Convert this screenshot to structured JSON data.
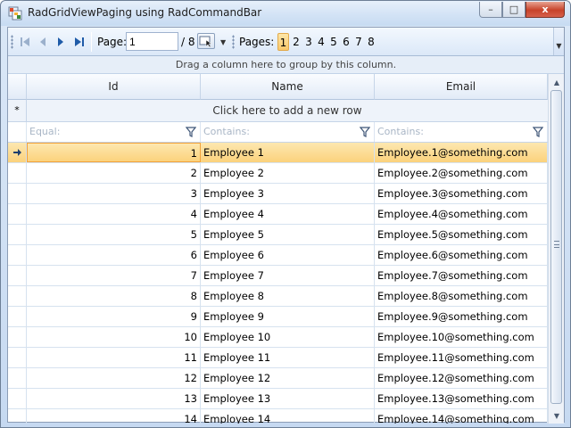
{
  "window": {
    "title": "RadGridViewPaging using RadCommandBar",
    "minimize_glyph": "–",
    "maximize_glyph": "□",
    "close_glyph": "x"
  },
  "commandbar": {
    "page_label": "Page:",
    "page_value": "1",
    "page_total": "/ 8",
    "pages_label": "Pages:",
    "pages": [
      "1",
      "2",
      "3",
      "4",
      "5",
      "6",
      "7",
      "8"
    ],
    "active_page": "1",
    "icons": [
      "first-page-icon",
      "previous-page-icon",
      "next-page-icon",
      "last-page-icon",
      "go-page-icon",
      "overflow-icon"
    ]
  },
  "grid": {
    "group_panel_text": "Drag a column here to group by this column.",
    "new_row_text": "Click here to add a new row",
    "new_row_glyph": "*",
    "columns": [
      {
        "header": "Id",
        "filter": "Equal:"
      },
      {
        "header": "Name",
        "filter": "Contains:"
      },
      {
        "header": "Email",
        "filter": "Contains:"
      }
    ],
    "current_row_index": 0,
    "rows": [
      {
        "id": "1",
        "name": "Employee 1",
        "email": "Employee.1@something.com"
      },
      {
        "id": "2",
        "name": "Employee 2",
        "email": "Employee.2@something.com"
      },
      {
        "id": "3",
        "name": "Employee 3",
        "email": "Employee.3@something.com"
      },
      {
        "id": "4",
        "name": "Employee 4",
        "email": "Employee.4@something.com"
      },
      {
        "id": "5",
        "name": "Employee 5",
        "email": "Employee.5@something.com"
      },
      {
        "id": "6",
        "name": "Employee 6",
        "email": "Employee.6@something.com"
      },
      {
        "id": "7",
        "name": "Employee 7",
        "email": "Employee.7@something.com"
      },
      {
        "id": "8",
        "name": "Employee 8",
        "email": "Employee.8@something.com"
      },
      {
        "id": "9",
        "name": "Employee 9",
        "email": "Employee.9@something.com"
      },
      {
        "id": "10",
        "name": "Employee 10",
        "email": "Employee.10@something.com"
      },
      {
        "id": "11",
        "name": "Employee 11",
        "email": "Employee.11@something.com"
      },
      {
        "id": "12",
        "name": "Employee 12",
        "email": "Employee.12@something.com"
      },
      {
        "id": "13",
        "name": "Employee 13",
        "email": "Employee.13@something.com"
      },
      {
        "id": "14",
        "name": "Employee 14",
        "email": "Employee.14@something.com"
      }
    ]
  },
  "colors": {
    "selected_row_top": "#fde8b0",
    "selected_row_bottom": "#fbd27c",
    "selected_border": "#f2a23a",
    "nav_arrow": "#1f5ba8"
  }
}
